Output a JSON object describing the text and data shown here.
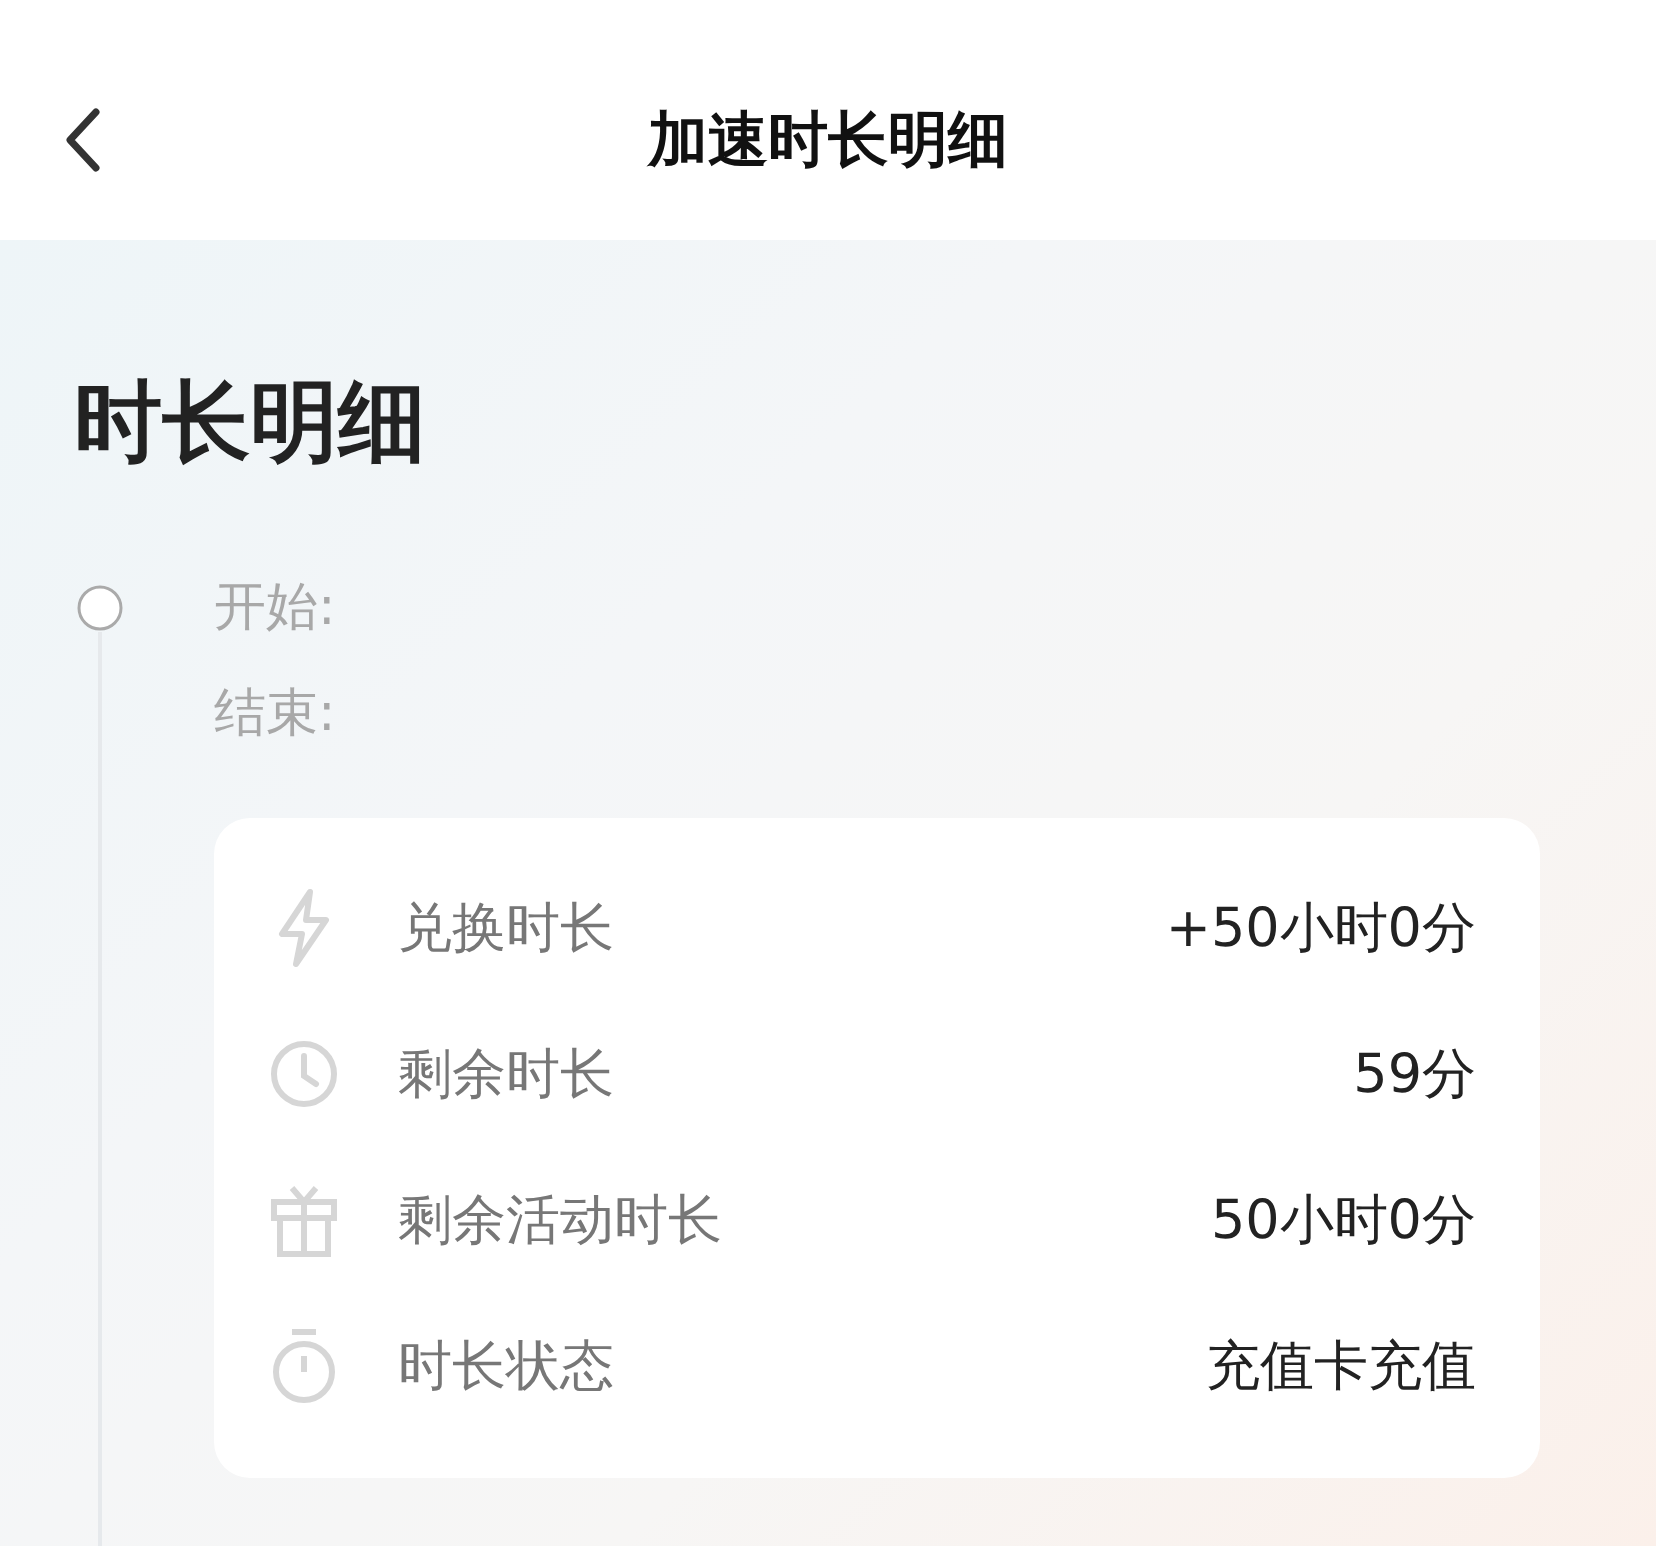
{
  "header": {
    "title": "加速时长明细"
  },
  "section": {
    "title": "时长明细"
  },
  "timeline": {
    "labels": [
      "开始:",
      "结束:"
    ]
  },
  "details": [
    {
      "label": "兑换时长",
      "value": "+50小时0分"
    },
    {
      "label": "剩余时长",
      "value": "59分"
    },
    {
      "label": "剩余活动时长",
      "value": "50小时0分"
    },
    {
      "label": "时长状态",
      "value": "充值卡充值"
    }
  ]
}
